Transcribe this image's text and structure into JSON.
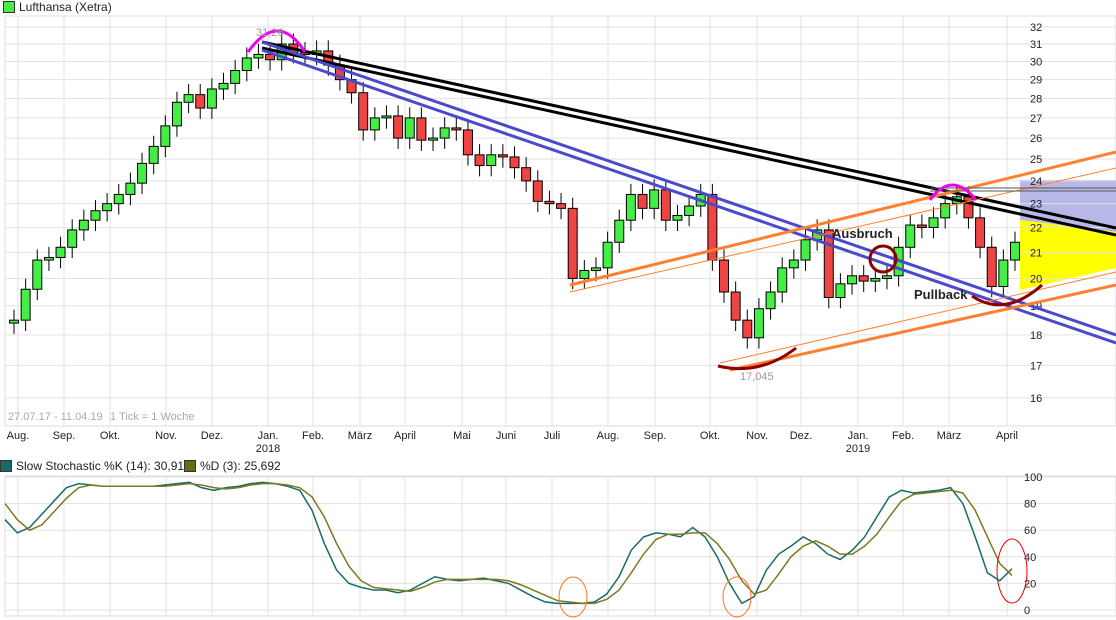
{
  "title": "Lufthansa (Xetra)",
  "colors": {
    "up": "#44ee44",
    "down": "#ee4444",
    "k": "#1a6a6a",
    "d": "#7a7a20"
  },
  "range_note": "27.07.17 - 11.04.19",
  "tick_note": "1 Tick = 1 Woche",
  "annotations": {
    "high": "31,26",
    "low": "17,045",
    "breakout": "Ausbruch",
    "pullback": "Pullback"
  },
  "chart_data": [
    {
      "type": "candlestick",
      "title": "Lufthansa (Xetra)",
      "ylim": [
        16,
        32
      ],
      "yscale": "log",
      "yticks": [
        16,
        17,
        18,
        19,
        20,
        21,
        22,
        23,
        24,
        25,
        26,
        27,
        28,
        29,
        30,
        31,
        32
      ],
      "xticks": [
        "Aug.",
        "Sep.",
        "Okt.",
        "Nov.",
        "Dez.",
        "Jan.",
        "Feb.",
        "März",
        "April",
        "Mai",
        "Juni",
        "Juli",
        "Aug.",
        "Sep.",
        "Okt.",
        "Nov.",
        "Dez.",
        "Jan.",
        "Feb.",
        "März",
        "April"
      ],
      "year_labels": {
        "Jan.": [
          "2018",
          "2019"
        ]
      },
      "first_open": 18.4,
      "closes": [
        18.5,
        19.6,
        20.7,
        20.8,
        21.2,
        21.9,
        22.3,
        22.7,
        23.0,
        23.4,
        23.9,
        24.8,
        25.6,
        26.6,
        27.8,
        28.2,
        27.5,
        28.5,
        28.8,
        29.5,
        30.2,
        30.4,
        30.1,
        31.0,
        30.5,
        30.4,
        30.6,
        29.8,
        29.0,
        28.3,
        26.4,
        27.0,
        27.1,
        26.0,
        27.0,
        25.9,
        26.0,
        26.5,
        26.4,
        25.2,
        24.7,
        25.2,
        25.1,
        24.6,
        24.0,
        23.1,
        23.0,
        22.8,
        20.0,
        20.3,
        20.4,
        21.4,
        22.3,
        23.4,
        22.8,
        23.6,
        22.3,
        22.5,
        22.9,
        23.4,
        20.7,
        19.5,
        18.5,
        17.9,
        18.9,
        19.5,
        20.4,
        20.7,
        21.5,
        21.9,
        19.3,
        19.8,
        20.1,
        19.9,
        20.0,
        20.1,
        21.2,
        22.1,
        22.0,
        22.4,
        23.0,
        23.3,
        22.4,
        21.2,
        19.7,
        20.7,
        21.4
      ]
    },
    {
      "type": "line",
      "title": "Slow Stochastic",
      "ylim": [
        0,
        100
      ],
      "yticks": [
        0,
        20,
        40,
        60,
        80,
        100
      ],
      "series": [
        {
          "name": "Slow Stochastic %K (14): 30,918",
          "values": [
            68,
            58,
            62,
            72,
            82,
            92,
            95,
            94,
            93,
            93,
            93,
            93,
            93,
            94,
            95,
            96,
            92,
            90,
            92,
            93,
            95,
            96,
            95,
            93,
            90,
            75,
            50,
            30,
            20,
            17,
            15,
            15,
            13,
            15,
            20,
            25,
            23,
            22,
            23,
            24,
            22,
            20,
            15,
            10,
            6,
            5,
            5,
            5,
            6,
            12,
            25,
            45,
            55,
            58,
            57,
            55,
            62,
            55,
            40,
            20,
            5,
            10,
            30,
            42,
            48,
            55,
            50,
            42,
            38,
            45,
            55,
            70,
            85,
            90,
            88,
            89,
            90,
            92,
            80,
            55,
            28,
            22,
            31
          ]
        },
        {
          "name": "%D (3): 25,692",
          "values": [
            80,
            68,
            60,
            64,
            74,
            84,
            92,
            94,
            93,
            93,
            93,
            93,
            93,
            93,
            94,
            95,
            94,
            92,
            91,
            92,
            94,
            95,
            95,
            94,
            92,
            85,
            70,
            50,
            33,
            22,
            17,
            16,
            15,
            14,
            17,
            21,
            23,
            23,
            23,
            23,
            23,
            22,
            19,
            15,
            11,
            7,
            6,
            5,
            5,
            8,
            15,
            28,
            42,
            53,
            57,
            57,
            58,
            58,
            50,
            38,
            22,
            12,
            15,
            27,
            40,
            48,
            52,
            48,
            42,
            42,
            48,
            57,
            70,
            82,
            87,
            88,
            89,
            90,
            88,
            75,
            55,
            35,
            26
          ]
        }
      ]
    }
  ]
}
